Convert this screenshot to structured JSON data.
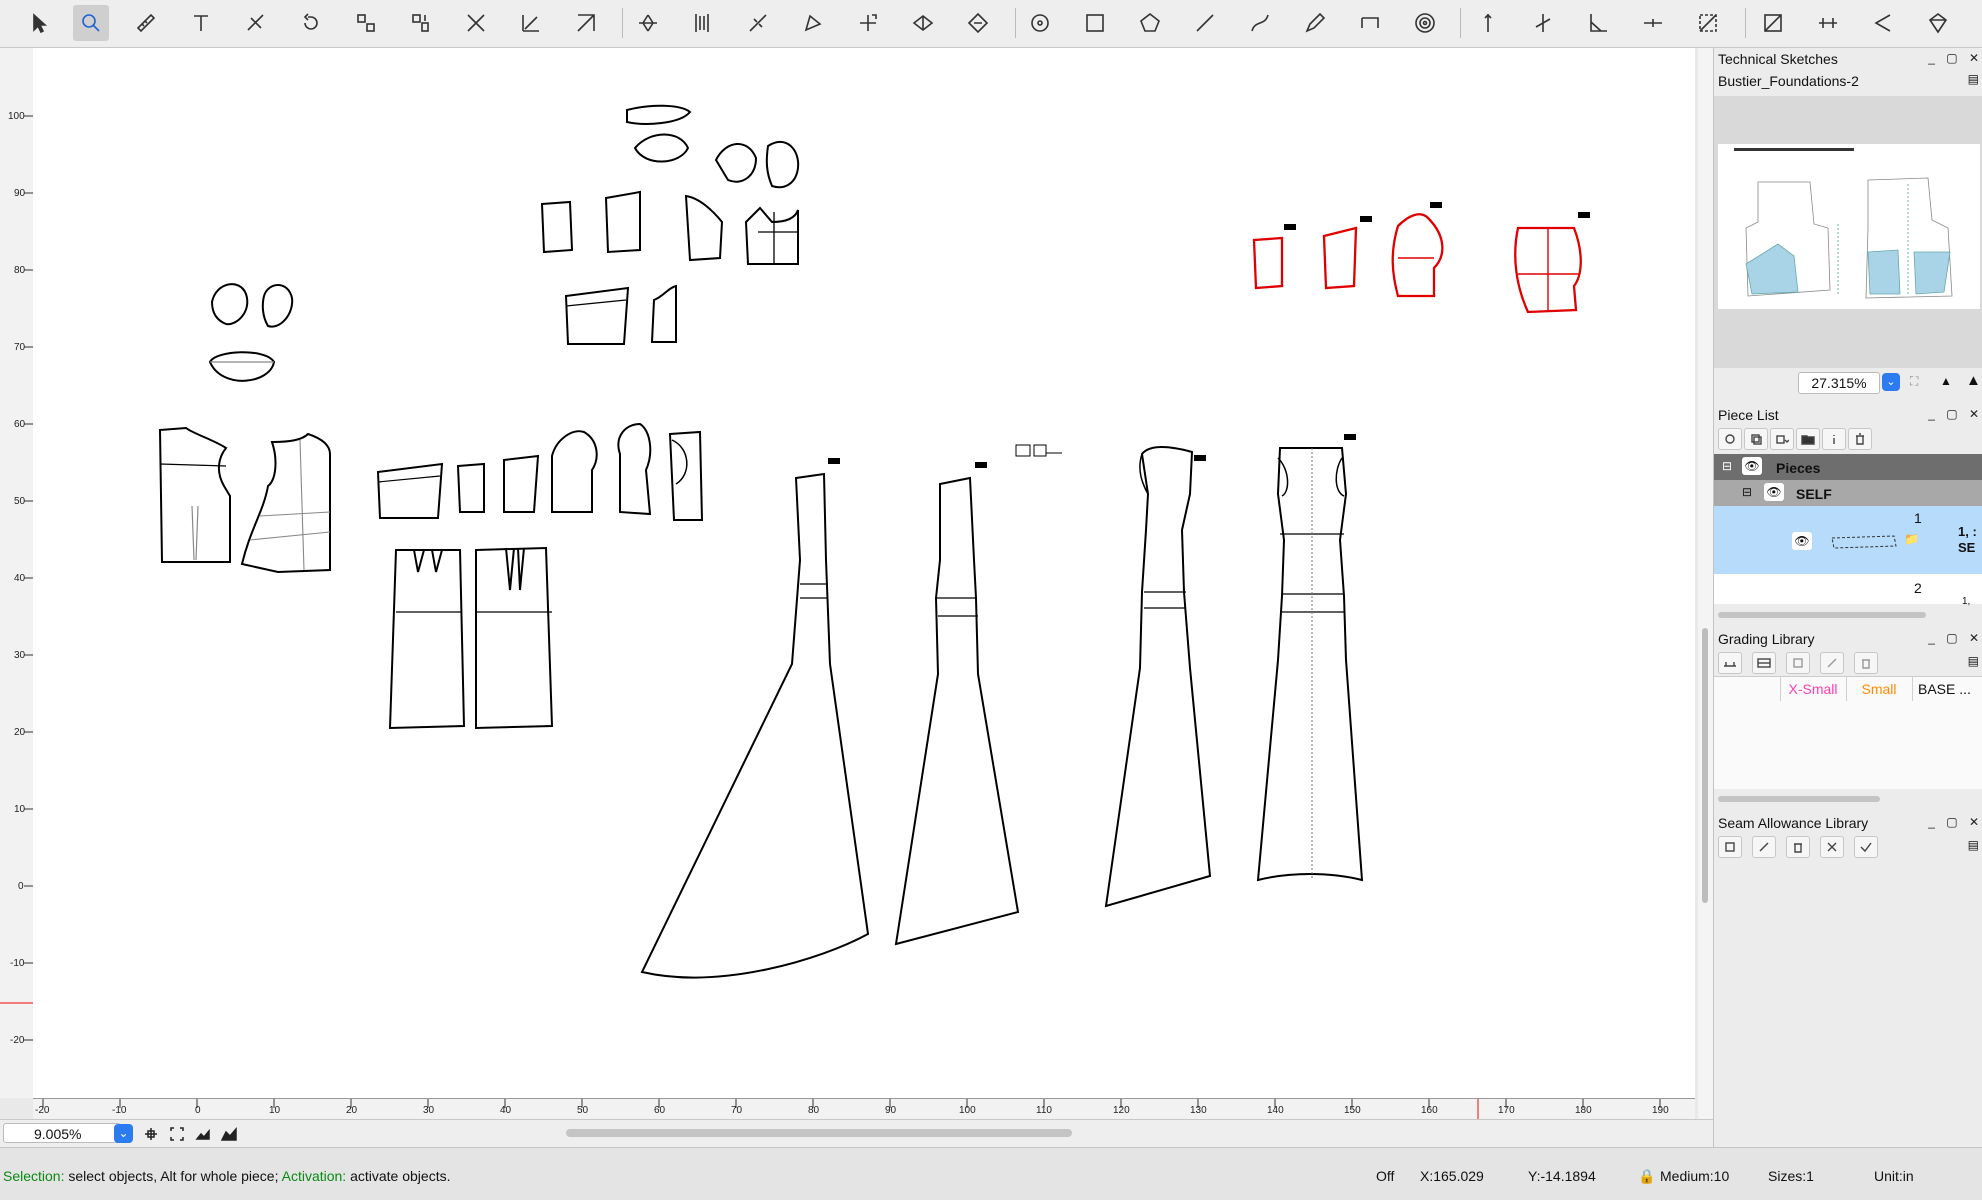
{
  "toolbar": {
    "tools": [
      {
        "name": "select-tool-icon",
        "active": false
      },
      {
        "name": "zoom-tool-icon",
        "active": true
      },
      {
        "name": "measure-tool-icon",
        "active": false
      },
      {
        "name": "text-tool-icon",
        "active": false
      },
      {
        "name": "slash-tool-icon",
        "active": false
      },
      {
        "name": "rotate-tool-icon",
        "active": false
      },
      {
        "name": "swap-tool-icon",
        "active": false
      },
      {
        "name": "flip-tool-icon",
        "active": false
      },
      {
        "name": "cross-tool-icon",
        "active": false
      },
      {
        "name": "axis-tool-icon",
        "active": false
      },
      {
        "name": "diagonal-tool-icon",
        "active": false
      },
      {
        "name": "dart-tool-icon",
        "active": false
      },
      {
        "name": "pleat-tool-icon",
        "active": false
      },
      {
        "name": "split-tool-icon",
        "active": false
      },
      {
        "name": "piece-tool-icon",
        "active": false
      },
      {
        "name": "transform-tool-icon",
        "active": false
      },
      {
        "name": "fold-tool-icon",
        "active": false
      },
      {
        "name": "move-tool-icon",
        "active": false
      },
      {
        "name": "circle-tool-icon",
        "active": false
      },
      {
        "name": "rectangle-tool-icon",
        "active": false
      },
      {
        "name": "polygon-tool-icon",
        "active": false
      },
      {
        "name": "line-tool-icon",
        "active": false
      },
      {
        "name": "curve-tool-icon",
        "active": false
      },
      {
        "name": "pen-tool-icon",
        "active": false
      },
      {
        "name": "path-tool-icon",
        "active": false
      },
      {
        "name": "spiral-tool-icon",
        "active": false
      },
      {
        "name": "notch-tool-icon",
        "active": false
      },
      {
        "name": "notch-cross-tool-icon",
        "active": false
      },
      {
        "name": "angle-tool-icon",
        "active": false
      },
      {
        "name": "point-tool-icon",
        "active": false
      },
      {
        "name": "grading-tool-icon",
        "active": false
      },
      {
        "name": "seam-tool-icon",
        "active": false
      },
      {
        "name": "stretch-tool-icon",
        "active": false
      },
      {
        "name": "mirror-tool-icon",
        "active": false
      },
      {
        "name": "gem-tool-icon",
        "active": false
      }
    ]
  },
  "rulers": {
    "vertical_labels": [
      "100",
      "90",
      "80",
      "70",
      "60",
      "50",
      "40",
      "30",
      "20",
      "10",
      "0",
      "-10",
      "-20"
    ],
    "horizontal_labels": [
      "-20",
      "-10",
      "0",
      "10",
      "20",
      "30",
      "40",
      "50",
      "60",
      "70",
      "80",
      "90",
      "100",
      "110",
      "120",
      "130",
      "140",
      "150",
      "160",
      "170",
      "180",
      "190"
    ]
  },
  "bottom": {
    "zoom_value": "9.005%"
  },
  "status": {
    "selection_label": "Selection:",
    "selection_text": " select objects, Alt for whole piece; ",
    "activation_label": "Activation:",
    "activation_text": " activate objects.",
    "snap": "Off",
    "x": "X:165.029",
    "y": "Y:-14.1894",
    "layer": "Medium:10",
    "sizes": "Sizes:1",
    "unit": "Unit:in"
  },
  "technical_sketches": {
    "title": "Technical Sketches",
    "file": "Bustier_Foundations-2",
    "zoom": "27.315%"
  },
  "piece_list": {
    "title": "Piece List",
    "group_pieces": "Pieces",
    "group_self": "SELF",
    "row1_number": "1",
    "row1_label_a": "1, :",
    "row1_label_b": "SE",
    "row2_number": "2",
    "row2_label": "1,"
  },
  "grading_library": {
    "title": "Grading Library",
    "sizes": [
      {
        "label": "X-Small",
        "color": "#ff3fb0"
      },
      {
        "label": "Small",
        "color": "#ff8c00"
      },
      {
        "label": "BASE ...",
        "color": "#111111"
      }
    ]
  },
  "seam_allowance_library": {
    "title": "Seam Allowance Library"
  }
}
